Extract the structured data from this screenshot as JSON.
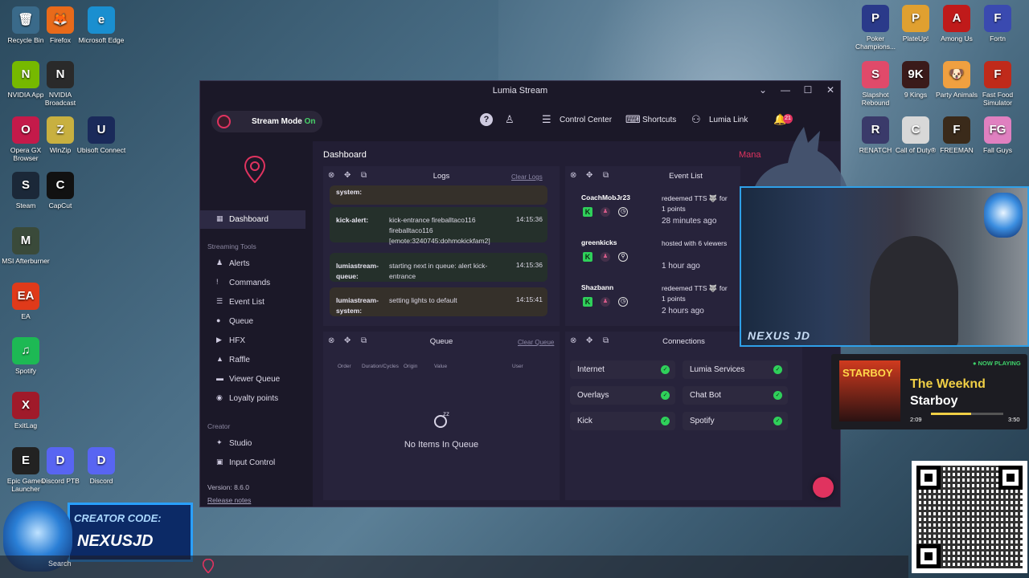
{
  "desktop": {
    "icons_left": [
      {
        "label": "Recycle Bin",
        "color": "#3a6a8a",
        "glyph": "🗑"
      },
      {
        "label": "Firefox",
        "color": "#e86a1a",
        "glyph": "🦊"
      },
      {
        "label": "Microsoft Edge",
        "color": "#1a8fd0",
        "glyph": "e"
      },
      {
        "label": "NVIDIA App",
        "color": "#76b900",
        "glyph": "N"
      },
      {
        "label": "NVIDIA Broadcast",
        "color": "#2a2a2a",
        "glyph": "N"
      },
      {
        "label": "Opera GX Browser",
        "color": "#c41a4a",
        "glyph": "O"
      },
      {
        "label": "WinZip",
        "color": "#c8b040",
        "glyph": "Z"
      },
      {
        "label": "Ubisoft Connect",
        "color": "#1a2a5a",
        "glyph": "U"
      },
      {
        "label": "Steam",
        "color": "#1b2838",
        "glyph": "S"
      },
      {
        "label": "CapCut",
        "color": "#111111",
        "glyph": "C"
      },
      {
        "label": "MSI Afterburner",
        "color": "#3a4a3a",
        "glyph": "M"
      },
      {
        "label": "EA",
        "color": "#e03a1a",
        "glyph": "EA"
      },
      {
        "label": "Spotify",
        "color": "#1db954",
        "glyph": "♫"
      },
      {
        "label": "ExitLag",
        "color": "#a01a2a",
        "glyph": "X"
      },
      {
        "label": "Epic Games Launcher",
        "color": "#222222",
        "glyph": "E"
      },
      {
        "label": "Discord PTB",
        "color": "#5865f2",
        "glyph": "D"
      },
      {
        "label": "Discord",
        "color": "#5865f2",
        "glyph": "D"
      }
    ],
    "icons_right": [
      {
        "label": "Poker Champions...",
        "color": "#2a3a8a",
        "glyph": "P"
      },
      {
        "label": "PlateUp!",
        "color": "#e0a030",
        "glyph": "P"
      },
      {
        "label": "Among Us",
        "color": "#c01a1a",
        "glyph": "A"
      },
      {
        "label": "Fortn",
        "color": "#3a4ab0",
        "glyph": "F"
      },
      {
        "label": "Slapshot Rebound",
        "color": "#e04a6a",
        "glyph": "S"
      },
      {
        "label": "9 Kings",
        "color": "#3a1a1a",
        "glyph": "9K"
      },
      {
        "label": "Party Animals",
        "color": "#f0a040",
        "glyph": "🐶"
      },
      {
        "label": "Fast Food Simulator",
        "color": "#c02a1a",
        "glyph": "F"
      },
      {
        "label": "RENATCH",
        "color": "#3a3a6a",
        "glyph": "R"
      },
      {
        "label": "Call of Duty®",
        "color": "#d8d8d8",
        "glyph": "C"
      },
      {
        "label": "FREEMAN",
        "color": "#3a2a1a",
        "glyph": "F"
      },
      {
        "label": "Fall Guys",
        "color": "#e080c0",
        "glyph": "FG"
      }
    ]
  },
  "window": {
    "title": "Lumia Stream",
    "controls": {
      "minimize": "—",
      "restore": "☐",
      "close": "✕"
    }
  },
  "topbar": {
    "stream_mode_label": "Stream Mode",
    "stream_mode_state": "On",
    "help_glyph": "?",
    "control_center": "Control Center",
    "shortcuts": "Shortcuts",
    "lumia_link": "Lumia Link",
    "notification_count": "21"
  },
  "sidebar": {
    "items": [
      {
        "label": "Dashboard",
        "icon": "▦",
        "active": true
      },
      {
        "label": "Alerts",
        "icon": "♟"
      },
      {
        "label": "Commands",
        "icon": "!"
      },
      {
        "label": "Event List",
        "icon": "☰"
      },
      {
        "label": "Queue",
        "icon": "●"
      },
      {
        "label": "HFX",
        "icon": "▶"
      },
      {
        "label": "Raffle",
        "icon": "▲"
      },
      {
        "label": "Viewer Queue",
        "icon": "▬"
      },
      {
        "label": "Loyalty points",
        "icon": "◉"
      }
    ],
    "section_streaming": "Streaming Tools",
    "section_creator": "Creator",
    "creator_items": [
      {
        "label": "Studio",
        "icon": "✦"
      },
      {
        "label": "Input Control",
        "icon": "▣"
      }
    ],
    "version": "Version: 8.6.0",
    "release_notes": "Release notes"
  },
  "main": {
    "title": "Dashboard",
    "top_link": "Mana",
    "logs": {
      "title": "Logs",
      "clear": "Clear Logs",
      "entries": [
        {
          "who": "system:",
          "msg": "",
          "time": "",
          "kind": "sys"
        },
        {
          "who": "kick-alert:",
          "msg": "kick-entrance fireballtaco116 fireballtaco116 [emote:3240745:dohmokickfam2]",
          "time": "14:15:36",
          "kind": "alert"
        },
        {
          "who": "lumiastream-queue:",
          "msg": "starting next in queue: alert kick-entrance",
          "time": "14:15:36",
          "kind": "alert"
        },
        {
          "who": "lumiastream-system:",
          "msg": "setting lights to default",
          "time": "14:15:41",
          "kind": "sys"
        }
      ]
    },
    "events": {
      "title": "Event List",
      "items": [
        {
          "name": "CoachMobJr23",
          "desc": "redeemed TTS 🐺 for 1 points",
          "time": "28 minutes ago",
          "third": "◷"
        },
        {
          "name": "greenkicks",
          "desc": "hosted with 6 viewers",
          "time": "1 hour ago",
          "third": "⚲"
        },
        {
          "name": "Shazbann",
          "desc": "redeemed TTS 🐺 for 1 points",
          "time": "2 hours ago",
          "third": "◷"
        }
      ],
      "kick_glyph": "K",
      "user_glyph": "♟"
    },
    "queue": {
      "title": "Queue",
      "clear": "Clear Queue",
      "columns": [
        "Order",
        "Duration/Cycles",
        "Origin",
        "Value",
        "User"
      ],
      "empty_icon": "zz",
      "empty_text": "No Items In Queue"
    },
    "connections": {
      "title": "Connections",
      "items": [
        {
          "label": "Internet",
          "ok": true
        },
        {
          "label": "Lumia Services",
          "ok": true
        },
        {
          "label": "Overlays",
          "ok": true
        },
        {
          "label": "Chat Bot",
          "ok": true
        },
        {
          "label": "Kick",
          "ok": true
        },
        {
          "label": "Spotify",
          "ok": true
        }
      ],
      "ok_glyph": "✓"
    },
    "panel_controls": {
      "close": "⊗",
      "move": "✥",
      "popout": "⧉"
    }
  },
  "overlays": {
    "webcam_label": "NEXUS JD",
    "now_playing": {
      "badge": "● NOW PLAYING",
      "album_text": "STARBOY",
      "artist": "The Weeknd",
      "song": "Starboy",
      "elapsed": "2:09",
      "total": "3:50",
      "progress": 0.56
    },
    "creator_line1": "CREATOR CODE:",
    "creator_line2": "NEXUSJD",
    "taskbar_search": "Search"
  },
  "colors": {
    "accent": "#e0335f",
    "ok": "#2fd05a",
    "window_bg": "#1e1a2e",
    "panel_bg": "#27233b"
  }
}
